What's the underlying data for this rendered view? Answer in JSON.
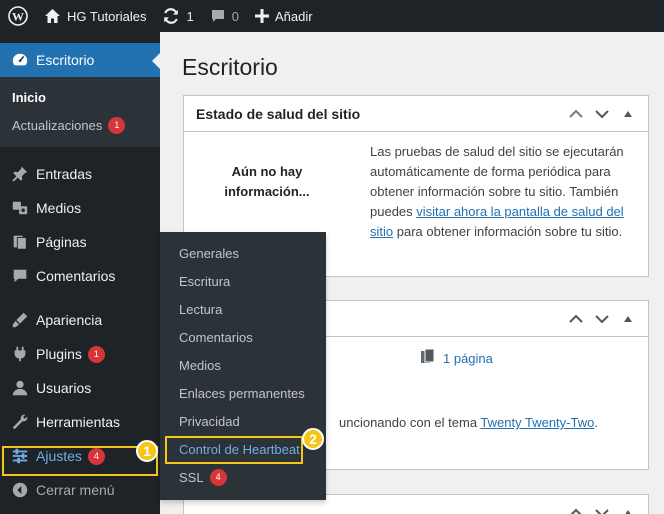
{
  "admin_bar": {
    "site_name": "HG Tutoriales",
    "updates_count": "1",
    "comments_count": "0",
    "new_label": "Añadir"
  },
  "sidebar": {
    "dashboard_label": "Escritorio",
    "submenu": [
      {
        "label": "Inicio"
      },
      {
        "label": "Actualizaciones",
        "badge": "1"
      }
    ],
    "items": [
      {
        "label": "Entradas",
        "icon": "pin-icon"
      },
      {
        "label": "Medios",
        "icon": "media-icon"
      },
      {
        "label": "Páginas",
        "icon": "pages-icon"
      },
      {
        "label": "Comentarios",
        "icon": "comment-icon"
      },
      {
        "label": "Apariencia",
        "icon": "appearance-icon"
      },
      {
        "label": "Plugins",
        "icon": "plugin-icon",
        "badge": "1"
      },
      {
        "label": "Usuarios",
        "icon": "users-icon"
      },
      {
        "label": "Herramientas",
        "icon": "tools-icon"
      },
      {
        "label": "Ajustes",
        "icon": "settings-icon",
        "badge": "4"
      }
    ],
    "collapse_label": "Cerrar menú"
  },
  "flyout": {
    "items": [
      {
        "label": "Generales"
      },
      {
        "label": "Escritura"
      },
      {
        "label": "Lectura"
      },
      {
        "label": "Comentarios"
      },
      {
        "label": "Medios"
      },
      {
        "label": "Enlaces permanentes"
      },
      {
        "label": "Privacidad"
      },
      {
        "label": "Control de Heartbeat"
      },
      {
        "label": "SSL",
        "badge": "4"
      }
    ]
  },
  "callouts": {
    "step1": "1",
    "step2": "2"
  },
  "main": {
    "title": "Escritorio",
    "health": {
      "title": "Estado de salud del sitio",
      "empty_state": "Aún no hay información...",
      "desc_before": "Las pruebas de salud del sitio se ejecutarán automáticamente de forma periódica para obtener información sobre tu sitio. También puedes ",
      "desc_link": "visitar ahora la pantalla de salud del sitio",
      "desc_after": " para obtener información sobre tu sitio."
    },
    "glance": {
      "pages": "1 página",
      "theme_text": "uncionando con el tema ",
      "theme_link": "Twenty Twenty-Two",
      "theme_end": "."
    }
  },
  "colors": {
    "admin_bg": "#1d2327",
    "submenu_bg": "#2c3338",
    "accent": "#2271b1",
    "badge": "#d63638",
    "highlight": "#f5c518"
  }
}
